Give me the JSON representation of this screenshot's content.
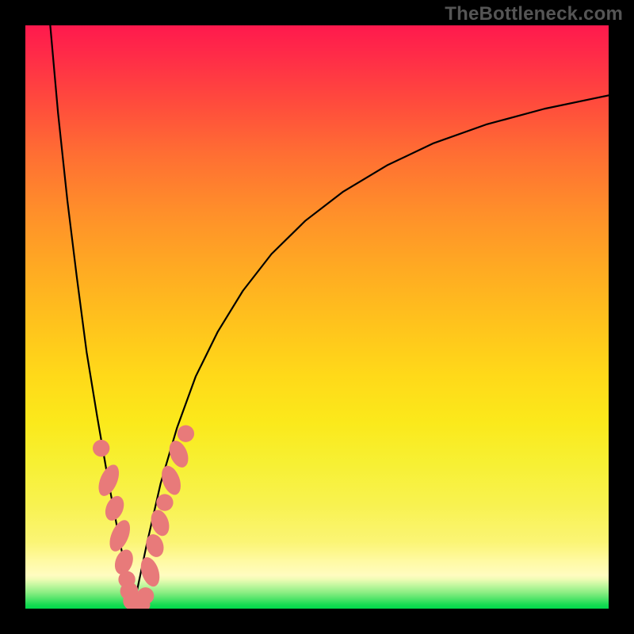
{
  "watermark": "TheBottleneck.com",
  "chart_data": {
    "type": "line",
    "title": "",
    "xlabel": "",
    "ylabel": "",
    "xlim": [
      0,
      100
    ],
    "ylim": [
      0,
      100
    ],
    "grid": false,
    "legend": false,
    "series": [
      {
        "name": "curve-left",
        "x": [
          4.0,
          5.6,
          7.2,
          8.8,
          10.5,
          12.3,
          14.2,
          16.1,
          18.5
        ],
        "y": [
          103.0,
          85.0,
          70.0,
          57.0,
          44.0,
          33.0,
          22.0,
          12.0,
          0.0
        ]
      },
      {
        "name": "curve-right",
        "x": [
          18.5,
          20.8,
          23.2,
          26.0,
          29.2,
          33.0,
          37.3,
          42.2,
          48.0,
          54.5,
          62.0,
          70.0,
          79.0,
          89.0,
          100.0
        ],
        "y": [
          0.0,
          11.0,
          21.5,
          31.0,
          39.8,
          47.5,
          54.5,
          60.8,
          66.5,
          71.5,
          76.0,
          79.8,
          83.0,
          85.7,
          88.0
        ]
      }
    ],
    "markers": {
      "name": "highlighted-points",
      "color": "#e87a7a",
      "points": [
        {
          "x": 13.0,
          "y": 27.5,
          "r": 1.45
        },
        {
          "x": 14.3,
          "y": 22.0,
          "rx": 1.45,
          "ry": 2.85,
          "rot": 23
        },
        {
          "x": 15.3,
          "y": 17.2,
          "rx": 1.45,
          "ry": 2.2,
          "rot": 23
        },
        {
          "x": 16.2,
          "y": 12.5,
          "rx": 1.45,
          "ry": 2.85,
          "rot": 23
        },
        {
          "x": 16.9,
          "y": 8.0,
          "rx": 1.45,
          "ry": 2.2,
          "rot": 20
        },
        {
          "x": 17.4,
          "y": 5.0,
          "r": 1.45
        },
        {
          "x": 17.8,
          "y": 3.0,
          "r": 1.55
        },
        {
          "x": 18.3,
          "y": 1.3,
          "r": 1.55
        },
        {
          "x": 19.4,
          "y": 0.7,
          "rx": 2.0,
          "ry": 1.5,
          "rot": 5
        },
        {
          "x": 20.6,
          "y": 2.2,
          "r": 1.45
        },
        {
          "x": 21.4,
          "y": 6.3,
          "rx": 1.45,
          "ry": 2.6,
          "rot": -18
        },
        {
          "x": 22.2,
          "y": 10.8,
          "rx": 1.45,
          "ry": 2.0,
          "rot": -18
        },
        {
          "x": 23.1,
          "y": 14.7,
          "rx": 1.45,
          "ry": 2.3,
          "rot": -18
        },
        {
          "x": 23.9,
          "y": 18.2,
          "r": 1.45
        },
        {
          "x": 25.0,
          "y": 22.0,
          "rx": 1.45,
          "ry": 2.6,
          "rot": -20
        },
        {
          "x": 26.3,
          "y": 26.5,
          "rx": 1.45,
          "ry": 2.4,
          "rot": -22
        },
        {
          "x": 27.5,
          "y": 30.0,
          "r": 1.45
        }
      ]
    }
  }
}
